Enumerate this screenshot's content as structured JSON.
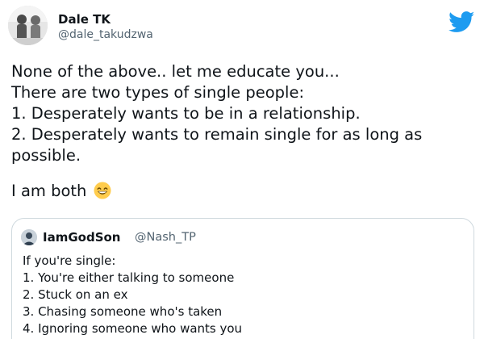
{
  "tweet": {
    "author": {
      "display_name": "Dale TK",
      "handle": "@dale_takudzwa"
    },
    "logo_icon": "twitter-bird-icon",
    "brand_color": "#1d9bf0",
    "text_lines": [
      "None of the above.. let me educate you...",
      "There are two types of single people:",
      "1. Desperately wants to be in a relationship.",
      "2. Desperately wants to remain single for as long as",
      "possible."
    ],
    "closing_line": "I am both",
    "closing_emoji": "grinning-face-with-smiling-eyes-emoji"
  },
  "quote": {
    "author": {
      "display_name": "IamGodSon",
      "handle": "@Nash_TP"
    },
    "intro": "If you're single:",
    "items": [
      "1. You're either talking to someone",
      "2. Stuck on an ex",
      "3. Chasing someone who's taken",
      "4. Ignoring someone who wants you"
    ]
  },
  "colors": {
    "text": "#0f1419",
    "secondary_text": "#536471",
    "border": "#cfd9de"
  }
}
